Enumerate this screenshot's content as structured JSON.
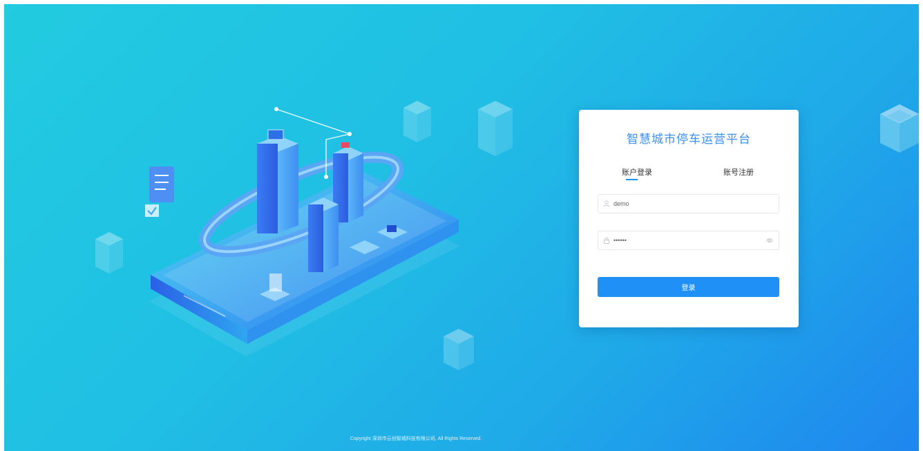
{
  "app": {
    "title": "智慧城市停车运营平台"
  },
  "tabs": {
    "login": "账户登录",
    "register": "账号注册"
  },
  "form": {
    "username_value": "demo",
    "password_value": "••••••",
    "login_button": "登录"
  },
  "footer": {
    "copyright": "Copyright 深圳市云创智城科技有限公司, All Rights Reserved."
  },
  "icons": {
    "username": "user-icon",
    "password": "lock-icon",
    "toggle_visibility": "eye-icon"
  },
  "colors": {
    "accent": "#1f90f5",
    "title": "#3b8ff3",
    "background_start": "#22cbe0",
    "background_end": "#1f86ef"
  }
}
